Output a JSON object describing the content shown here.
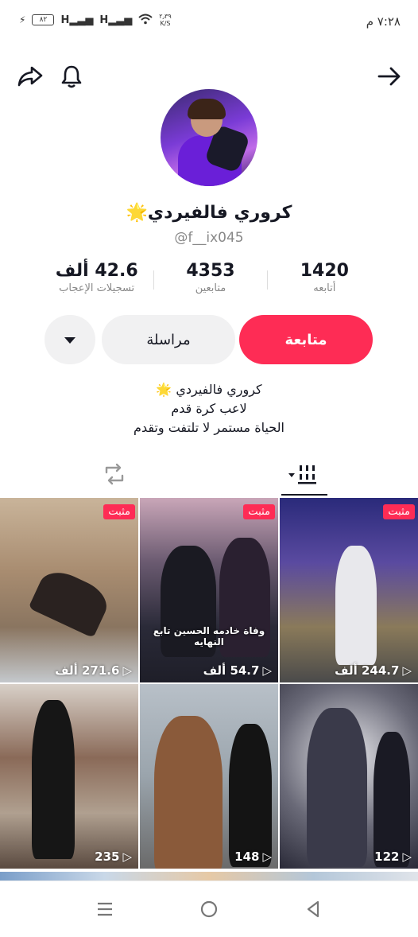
{
  "status_bar": {
    "time": "٧:٢٨ م",
    "battery": "٨٢",
    "signal1": "H",
    "signal2": "H",
    "net_speed": "٢٫٣٩",
    "net_unit": "K/S"
  },
  "profile": {
    "display_name": "كروري فالفيردي🌟",
    "handle": "@f__ix045"
  },
  "stats": [
    {
      "value": "1420",
      "label": "أتابعه"
    },
    {
      "value": "4353",
      "label": "متابعين"
    },
    {
      "value": "42.6 ألف",
      "label": "تسجيلات الإعجاب"
    }
  ],
  "buttons": {
    "follow": "متابعة",
    "message": "مراسلة"
  },
  "bio": {
    "line1": "كروري فالفيردي 🌟",
    "line2": "لاعب كرة قدم",
    "line3": "الحياة مستمر لا تلتفت وتقدم"
  },
  "videos": [
    {
      "views": "271.6 ألف",
      "pinned": "مثبت",
      "caption": ""
    },
    {
      "views": "54.7 ألف",
      "pinned": "مثبت",
      "caption": "وفاة خادمه الحسين تابع النهايه"
    },
    {
      "views": "244.7 ألف",
      "pinned": "مثبت",
      "caption": ""
    },
    {
      "views": "235",
      "pinned": "",
      "caption": ""
    },
    {
      "views": "148",
      "pinned": "",
      "caption": ""
    },
    {
      "views": "122",
      "pinned": "",
      "caption": ""
    }
  ],
  "colors": {
    "accent": "#fe2c55",
    "text": "#161823",
    "muted": "#888888",
    "button_bg": "#f1f1f2"
  }
}
